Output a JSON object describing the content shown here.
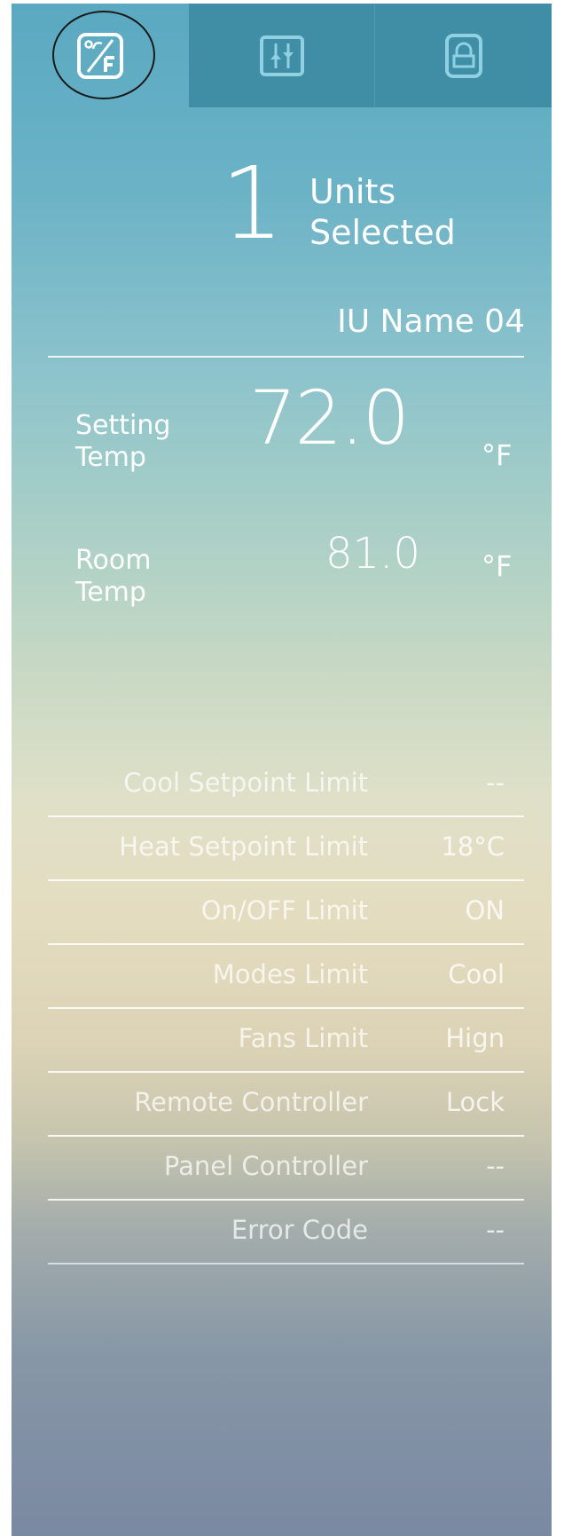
{
  "tabs": [
    {
      "name": "temperature-tab",
      "icon": "temperature-f-icon"
    },
    {
      "name": "adjust-tab",
      "icon": "sliders-icon"
    },
    {
      "name": "lock-tab",
      "icon": "lock-icon"
    }
  ],
  "selection": {
    "count": "1",
    "line1": "Units",
    "line2": "Selected",
    "unit_name": "IU Name 04"
  },
  "setting": {
    "label_line1": "Setting",
    "label_line2": "Temp",
    "value": "72.0",
    "unit": "°F"
  },
  "room": {
    "label_line1": "Room",
    "label_line2": "Temp",
    "value": "81.0",
    "unit": "°F"
  },
  "limits": [
    {
      "label": "Cool Setpoint Limit",
      "value": "--"
    },
    {
      "label": "Heat Setpoint Limit",
      "value": "18°C"
    },
    {
      "label": "On/OFF Limit",
      "value": "ON"
    },
    {
      "label": "Modes Limit",
      "value": "Cool"
    },
    {
      "label": "Fans Limit",
      "value": "Hign"
    },
    {
      "label": "Remote Controller",
      "value": "Lock"
    },
    {
      "label": "Panel Controller",
      "value": "--"
    },
    {
      "label": "Error Code",
      "value": "--"
    }
  ]
}
